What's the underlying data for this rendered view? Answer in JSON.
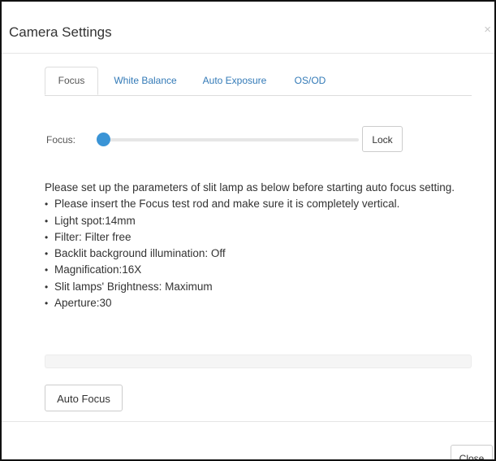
{
  "dialog": {
    "title": "Camera Settings",
    "close_icon": "×"
  },
  "tabs": [
    {
      "label": "Focus",
      "active": true
    },
    {
      "label": "White Balance",
      "active": false
    },
    {
      "label": "Auto Exposure",
      "active": false
    },
    {
      "label": "OS/OD",
      "active": false
    }
  ],
  "focus": {
    "label": "Focus:",
    "slider_value": 0,
    "lock_label": "Lock"
  },
  "instructions": {
    "intro": "Please set up the parameters of slit lamp as below before starting auto focus setting.",
    "items": [
      "Please insert the Focus test rod and make sure it is completely vertical.",
      "Light spot:14mm",
      "Filter: Filter free",
      "Backlit background illumination: Off",
      "Magnification:16X",
      "Slit lamps' Brightness: Maximum",
      "Aperture:30"
    ]
  },
  "progress": {
    "value": 0
  },
  "actions": {
    "auto_focus_label": "Auto Focus",
    "close_label": "Close"
  },
  "colors": {
    "accent": "#3a94d6",
    "link": "#337ab7"
  }
}
